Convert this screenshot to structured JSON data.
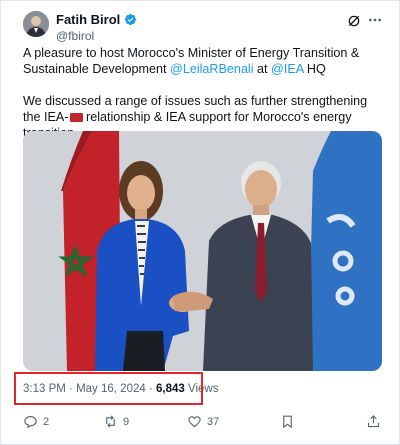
{
  "author": {
    "name": "Fatih Birol",
    "handle": "@fbirol"
  },
  "tweet": {
    "line1_part1": "A pleasure to host Morocco's Minister of Energy Transition & Sustainable Development ",
    "mention_user": "@LeilaRBenali",
    "line1_part2": " at ",
    "mention_org": "@IEA",
    "line1_part3": " HQ",
    "paragraph2_part1": "We discussed a range of issues such as further strengthening the IEA-",
    "paragraph2_part2": " relationship & IEA support for Morocco's energy transition"
  },
  "meta": {
    "time": "3:13 PM",
    "separator": "·",
    "date": "May 16, 2024",
    "separator2": "·",
    "views_count": "6,843",
    "views_label": "Views"
  },
  "actions": {
    "replies": "2",
    "reposts": "9",
    "likes": "37"
  },
  "colors": {
    "accent": "#1d9bf0",
    "highlight": "#e0262b",
    "secondary_text": "#536471"
  }
}
